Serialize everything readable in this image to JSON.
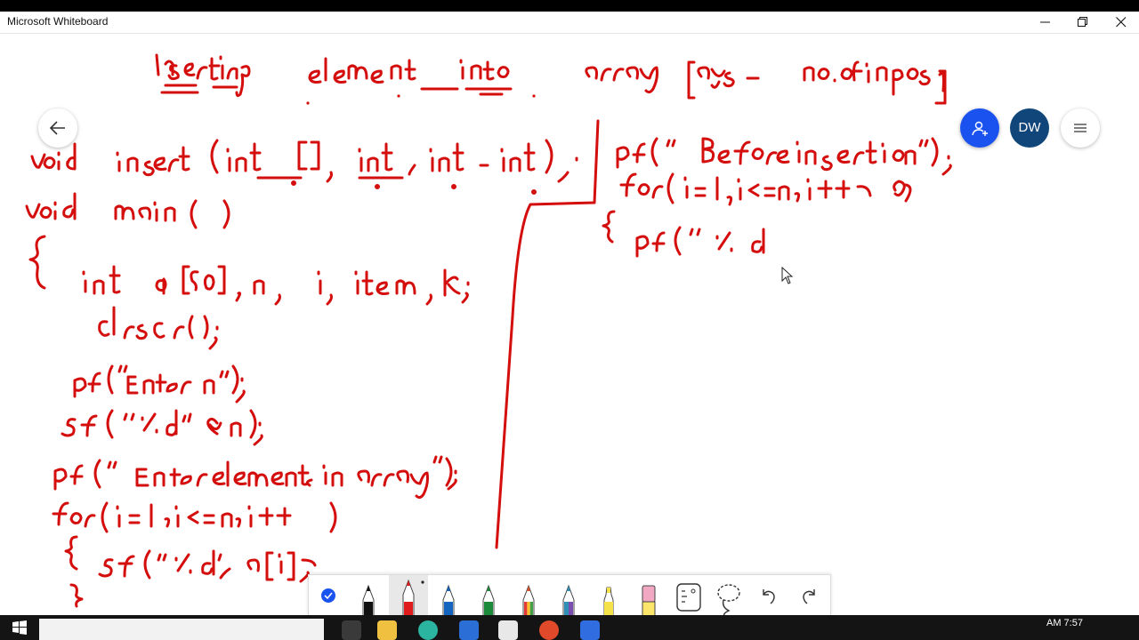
{
  "window": {
    "app_title": "Microsoft Whiteboard",
    "controls": [
      "minimize",
      "restore",
      "close"
    ]
  },
  "header": {
    "back_icon": "arrow-left-icon",
    "invite_icon": "person-add-icon",
    "user_initials": "DW",
    "menu_icon": "hamburger-menu-icon",
    "accent_color": "#1a52f0",
    "avatar_color": "#11467a"
  },
  "whiteboard": {
    "ink_color": "#d40d0d",
    "handwritten_lines": [
      "inserting element into array [args - no.ofinpos]",
      "void insert (int [ ], int , int , int ) ;",
      "void main ( )",
      "{",
      "int a[50] , n , i , item , k ;",
      "clrscr ( ) ;",
      "pf ( \"Enter n\" ) ;",
      "sf ( \" %d \" , &n ) ;",
      "pf ( \" Enter elements in array \" ) ;",
      "for ( i = 1 ; i <= n ; i++ )",
      "{ sf ( \" %d \" , a[ i ] ) ;",
      "}",
      "pf ( \" Before insertion \" ) ;",
      "for ( i = 1 ; i <= n ; i++ )",
      "{ pf ( \" %d"
    ]
  },
  "toolbar": {
    "tools": [
      {
        "name": "select",
        "icon": "checkmark-circle-icon"
      },
      {
        "name": "pen-black",
        "icon": "pen-icon",
        "color": "#111111"
      },
      {
        "name": "pen-red",
        "icon": "pen-icon",
        "color": "#e01b1b",
        "active": true
      },
      {
        "name": "pen-blue",
        "icon": "pen-icon",
        "color": "#1565c0"
      },
      {
        "name": "pen-green",
        "icon": "pen-icon",
        "color": "#1b8a3a"
      },
      {
        "name": "pen-rainbow",
        "icon": "pen-icon",
        "color": "#d8522a"
      },
      {
        "name": "pen-galaxy",
        "icon": "pen-icon",
        "color": "#2f8fb5"
      },
      {
        "name": "highlighter",
        "icon": "highlighter-icon",
        "color": "#f5e14a"
      },
      {
        "name": "eraser",
        "icon": "eraser-icon",
        "color": "#f2a7c3"
      },
      {
        "name": "ruler",
        "icon": "ruler-icon"
      },
      {
        "name": "lasso",
        "icon": "lasso-icon"
      },
      {
        "name": "undo",
        "icon": "undo-icon"
      },
      {
        "name": "redo",
        "icon": "redo-icon"
      }
    ]
  },
  "taskbar": {
    "clock_time": "AM 7:57"
  }
}
